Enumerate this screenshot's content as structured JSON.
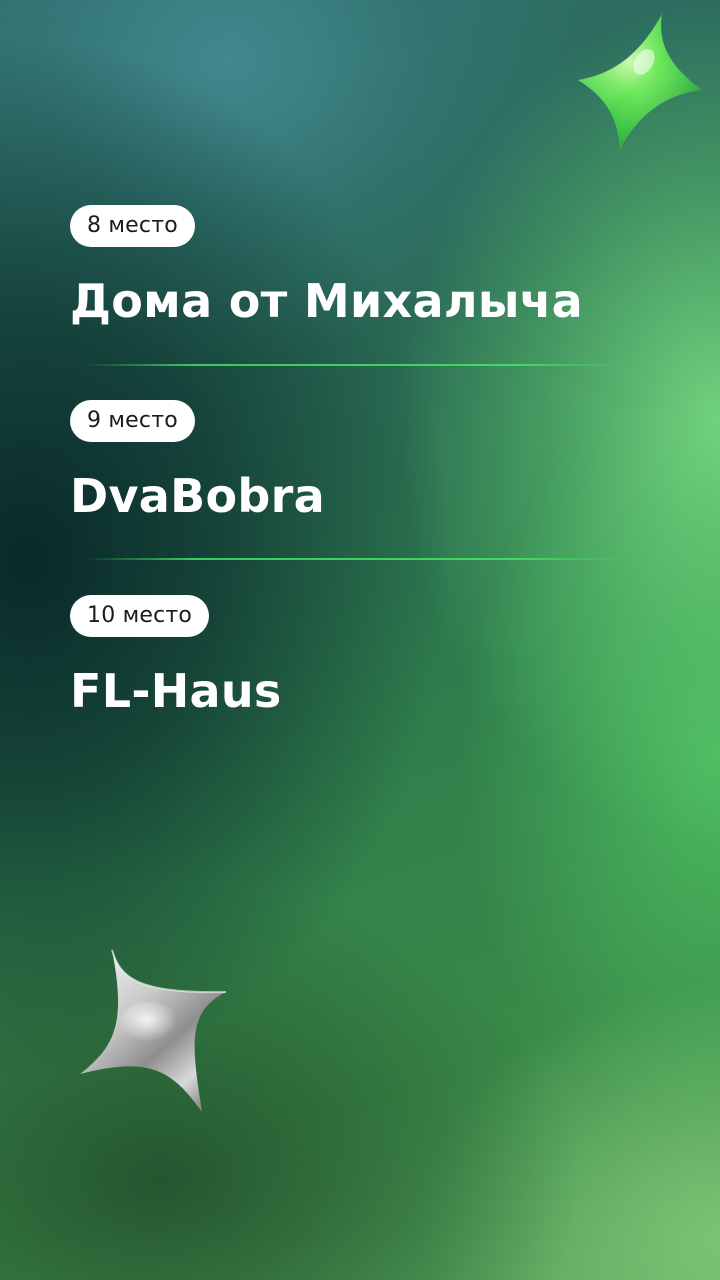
{
  "colors": {
    "accent_green": "#3ccf5e",
    "badge_bg": "#ffffff",
    "badge_text": "#1c1c1c",
    "name_text": "#ffffff"
  },
  "entries": [
    {
      "place": "8 место",
      "name": "Дома от Михалыча"
    },
    {
      "place": "9 место",
      "name": "DvaBobra"
    },
    {
      "place": "10 место",
      "name": "FL-Haus"
    }
  ],
  "decorations": {
    "top_star": "green-sparkle-star-icon",
    "bottom_star": "silver-sparkle-star-icon"
  }
}
